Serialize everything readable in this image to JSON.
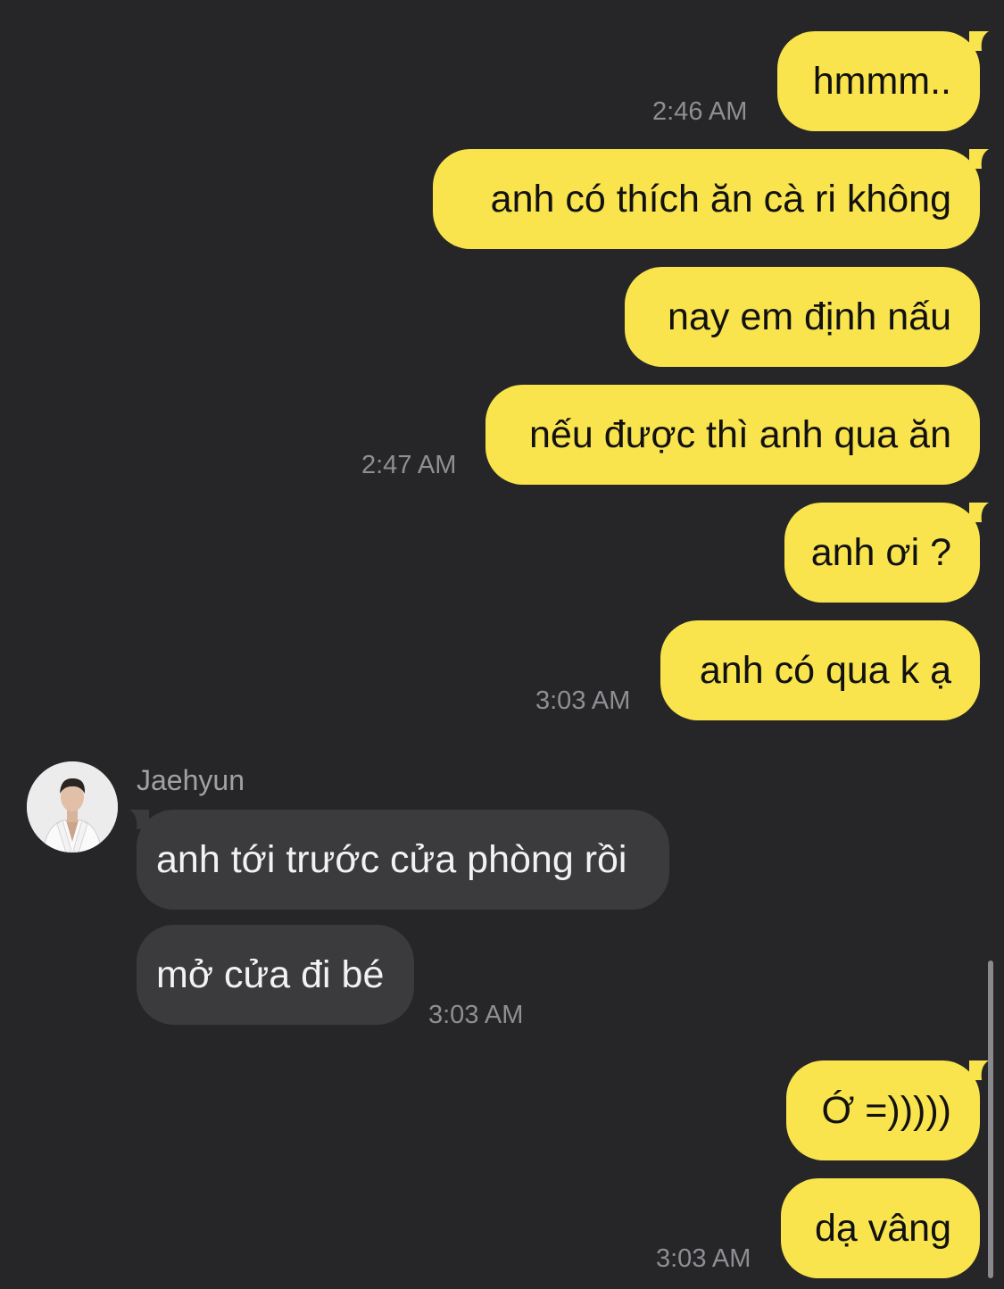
{
  "colors": {
    "background": "#262628",
    "sent_bubble": "#f9e44d",
    "received_bubble": "#3b3b3d",
    "timestamp": "#8e8e93"
  },
  "contact": {
    "name": "Jaehyun",
    "avatar_icon": "profile-photo"
  },
  "messages": [
    {
      "direction": "sent",
      "text": "hmmm..",
      "time": "2:46 AM"
    },
    {
      "direction": "sent",
      "text": "anh có thích ăn cà ri không"
    },
    {
      "direction": "sent",
      "text": "nay em định nấu"
    },
    {
      "direction": "sent",
      "text": "nếu được thì anh qua ăn",
      "time": "2:47 AM"
    },
    {
      "direction": "sent",
      "text": "anh ơi ?"
    },
    {
      "direction": "sent",
      "text": "anh có qua k ạ",
      "time": "3:03 AM"
    },
    {
      "direction": "received",
      "text": "anh tới trước cửa phòng rồi"
    },
    {
      "direction": "received",
      "text": "mở cửa đi bé",
      "time": "3:03 AM"
    },
    {
      "direction": "sent",
      "text": "Ớ =)))))"
    },
    {
      "direction": "sent",
      "text": "dạ vâng",
      "time": "3:03 AM"
    }
  ]
}
